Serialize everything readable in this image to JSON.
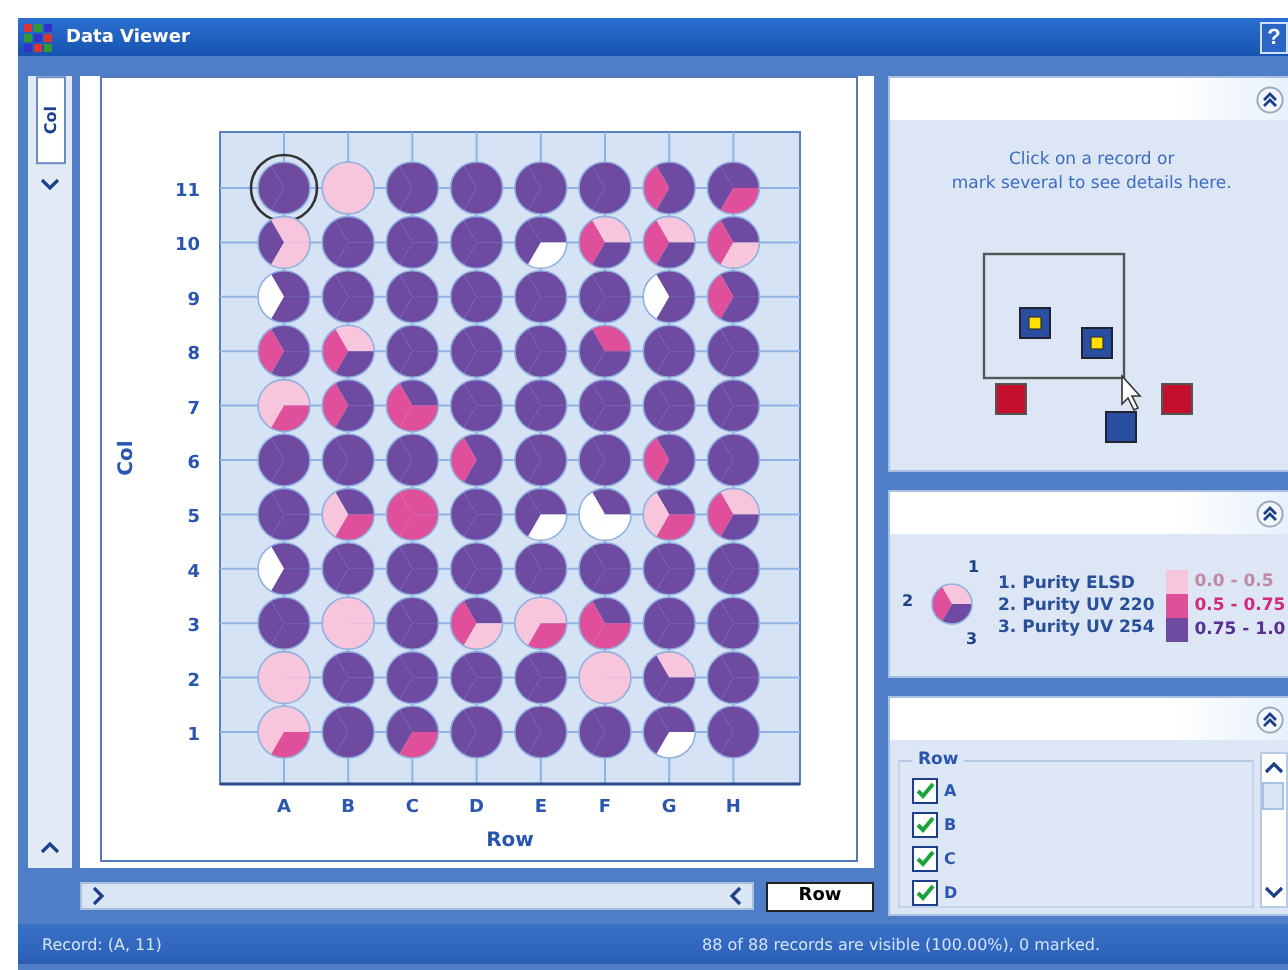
{
  "window": {
    "title": "Data Viewer",
    "help": "?"
  },
  "plot": {
    "tab": "Col",
    "y_title": "Col",
    "x_title": "Row",
    "columns": [
      "A",
      "B",
      "C",
      "D",
      "E",
      "F",
      "G",
      "H"
    ],
    "rows": [
      {
        "label": "11",
        "wells": [
          {
            "purity": [
              {
                "kind": "high"
              },
              {
                "kind": "high"
              },
              {
                "kind": "high"
              }
            ],
            "selected": true
          },
          {
            "purity": [
              {
                "kind": "low"
              },
              {
                "kind": "low"
              },
              {
                "kind": "low"
              }
            ],
            "selected": false
          },
          {
            "purity": [
              {
                "kind": "high"
              },
              {
                "kind": "high"
              },
              {
                "kind": "high"
              }
            ],
            "selected": false
          },
          {
            "purity": [
              {
                "kind": "high"
              },
              {
                "kind": "high"
              },
              {
                "kind": "high"
              }
            ],
            "selected": false
          },
          {
            "purity": [
              {
                "kind": "high"
              },
              {
                "kind": "high"
              },
              {
                "kind": "high"
              }
            ],
            "selected": false
          },
          {
            "purity": [
              {
                "kind": "high"
              },
              {
                "kind": "high"
              },
              {
                "kind": "high"
              }
            ],
            "selected": false
          },
          {
            "purity": [
              {
                "kind": "high"
              },
              {
                "kind": "mid"
              },
              {
                "kind": "high"
              }
            ],
            "selected": false
          },
          {
            "purity": [
              {
                "kind": "high"
              },
              {
                "kind": "high"
              },
              {
                "kind": "mid"
              }
            ],
            "selected": false
          }
        ]
      },
      {
        "label": "10",
        "wells": [
          {
            "purity": [
              {
                "kind": "low"
              },
              {
                "kind": "high"
              },
              {
                "kind": "low"
              }
            ],
            "selected": false
          },
          {
            "purity": [
              {
                "kind": "high"
              },
              {
                "kind": "high"
              },
              {
                "kind": "high"
              }
            ],
            "selected": false
          },
          {
            "purity": [
              {
                "kind": "high"
              },
              {
                "kind": "high"
              },
              {
                "kind": "high"
              }
            ],
            "selected": false
          },
          {
            "purity": [
              {
                "kind": "high"
              },
              {
                "kind": "high"
              },
              {
                "kind": "high"
              }
            ],
            "selected": false
          },
          {
            "purity": [
              {
                "kind": "high"
              },
              {
                "kind": "high"
              },
              {
                "kind": "none"
              }
            ],
            "selected": false
          },
          {
            "purity": [
              {
                "kind": "low"
              },
              {
                "kind": "mid"
              },
              {
                "kind": "high"
              }
            ],
            "selected": false
          },
          {
            "purity": [
              {
                "kind": "low"
              },
              {
                "kind": "mid"
              },
              {
                "kind": "high"
              }
            ],
            "selected": false
          },
          {
            "purity": [
              {
                "kind": "high"
              },
              {
                "kind": "mid"
              },
              {
                "kind": "low"
              }
            ],
            "selected": false
          }
        ]
      },
      {
        "label": "9",
        "wells": [
          {
            "purity": [
              {
                "kind": "high"
              },
              {
                "kind": "none"
              },
              {
                "kind": "high"
              }
            ],
            "selected": false
          },
          {
            "purity": [
              {
                "kind": "high"
              },
              {
                "kind": "high"
              },
              {
                "kind": "high"
              }
            ],
            "selected": false
          },
          {
            "purity": [
              {
                "kind": "high"
              },
              {
                "kind": "high"
              },
              {
                "kind": "high"
              }
            ],
            "selected": false
          },
          {
            "purity": [
              {
                "kind": "high"
              },
              {
                "kind": "high"
              },
              {
                "kind": "high"
              }
            ],
            "selected": false
          },
          {
            "purity": [
              {
                "kind": "high"
              },
              {
                "kind": "high"
              },
              {
                "kind": "high"
              }
            ],
            "selected": false
          },
          {
            "purity": [
              {
                "kind": "high"
              },
              {
                "kind": "high"
              },
              {
                "kind": "high"
              }
            ],
            "selected": false
          },
          {
            "purity": [
              {
                "kind": "high"
              },
              {
                "kind": "none"
              },
              {
                "kind": "high"
              }
            ],
            "selected": false
          },
          {
            "purity": [
              {
                "kind": "high"
              },
              {
                "kind": "mid"
              },
              {
                "kind": "high"
              }
            ],
            "selected": false
          }
        ]
      },
      {
        "label": "8",
        "wells": [
          {
            "purity": [
              {
                "kind": "high"
              },
              {
                "kind": "mid"
              },
              {
                "kind": "high"
              }
            ],
            "selected": false
          },
          {
            "purity": [
              {
                "kind": "low"
              },
              {
                "kind": "mid"
              },
              {
                "kind": "high"
              }
            ],
            "selected": false
          },
          {
            "purity": [
              {
                "kind": "high"
              },
              {
                "kind": "high"
              },
              {
                "kind": "high"
              }
            ],
            "selected": false
          },
          {
            "purity": [
              {
                "kind": "high"
              },
              {
                "kind": "high"
              },
              {
                "kind": "high"
              }
            ],
            "selected": false
          },
          {
            "purity": [
              {
                "kind": "high"
              },
              {
                "kind": "high"
              },
              {
                "kind": "high"
              }
            ],
            "selected": false
          },
          {
            "purity": [
              {
                "kind": "mid"
              },
              {
                "kind": "high"
              },
              {
                "kind": "high"
              }
            ],
            "selected": false
          },
          {
            "purity": [
              {
                "kind": "high"
              },
              {
                "kind": "high"
              },
              {
                "kind": "high"
              }
            ],
            "selected": false
          },
          {
            "purity": [
              {
                "kind": "high"
              },
              {
                "kind": "high"
              },
              {
                "kind": "high"
              }
            ],
            "selected": false
          }
        ]
      },
      {
        "label": "7",
        "wells": [
          {
            "purity": [
              {
                "kind": "low"
              },
              {
                "kind": "low"
              },
              {
                "kind": "mid"
              }
            ],
            "selected": false
          },
          {
            "purity": [
              {
                "kind": "high"
              },
              {
                "kind": "mid"
              },
              {
                "kind": "high"
              }
            ],
            "selected": false
          },
          {
            "purity": [
              {
                "kind": "high"
              },
              {
                "kind": "mid"
              },
              {
                "kind": "mid"
              }
            ],
            "selected": false
          },
          {
            "purity": [
              {
                "kind": "high"
              },
              {
                "kind": "high"
              },
              {
                "kind": "high"
              }
            ],
            "selected": false
          },
          {
            "purity": [
              {
                "kind": "high"
              },
              {
                "kind": "high"
              },
              {
                "kind": "high"
              }
            ],
            "selected": false
          },
          {
            "purity": [
              {
                "kind": "high"
              },
              {
                "kind": "high"
              },
              {
                "kind": "high"
              }
            ],
            "selected": false
          },
          {
            "purity": [
              {
                "kind": "high"
              },
              {
                "kind": "high"
              },
              {
                "kind": "high"
              }
            ],
            "selected": false
          },
          {
            "purity": [
              {
                "kind": "high"
              },
              {
                "kind": "high"
              },
              {
                "kind": "high"
              }
            ],
            "selected": false
          }
        ]
      },
      {
        "label": "6",
        "wells": [
          {
            "purity": [
              {
                "kind": "high"
              },
              {
                "kind": "high"
              },
              {
                "kind": "high"
              }
            ],
            "selected": false
          },
          {
            "purity": [
              {
                "kind": "high"
              },
              {
                "kind": "high"
              },
              {
                "kind": "high"
              }
            ],
            "selected": false
          },
          {
            "purity": [
              {
                "kind": "high"
              },
              {
                "kind": "high"
              },
              {
                "kind": "high"
              }
            ],
            "selected": false
          },
          {
            "purity": [
              {
                "kind": "high"
              },
              {
                "kind": "mid"
              },
              {
                "kind": "high"
              }
            ],
            "selected": false
          },
          {
            "purity": [
              {
                "kind": "high"
              },
              {
                "kind": "high"
              },
              {
                "kind": "high"
              }
            ],
            "selected": false
          },
          {
            "purity": [
              {
                "kind": "high"
              },
              {
                "kind": "high"
              },
              {
                "kind": "high"
              }
            ],
            "selected": false
          },
          {
            "purity": [
              {
                "kind": "high"
              },
              {
                "kind": "mid"
              },
              {
                "kind": "high"
              }
            ],
            "selected": false
          },
          {
            "purity": [
              {
                "kind": "high"
              },
              {
                "kind": "high"
              },
              {
                "kind": "high"
              }
            ],
            "selected": false
          }
        ]
      },
      {
        "label": "5",
        "wells": [
          {
            "purity": [
              {
                "kind": "high"
              },
              {
                "kind": "high"
              },
              {
                "kind": "high"
              }
            ],
            "selected": false
          },
          {
            "purity": [
              {
                "kind": "high"
              },
              {
                "kind": "low"
              },
              {
                "kind": "mid"
              }
            ],
            "selected": false
          },
          {
            "purity": [
              {
                "kind": "mid"
              },
              {
                "kind": "mid"
              },
              {
                "kind": "mid"
              }
            ],
            "selected": false
          },
          {
            "purity": [
              {
                "kind": "high"
              },
              {
                "kind": "high"
              },
              {
                "kind": "high"
              }
            ],
            "selected": false
          },
          {
            "purity": [
              {
                "kind": "high"
              },
              {
                "kind": "high"
              },
              {
                "kind": "none"
              }
            ],
            "selected": false
          },
          {
            "purity": [
              {
                "kind": "high"
              },
              {
                "kind": "none"
              },
              {
                "kind": "none"
              }
            ],
            "selected": false
          },
          {
            "purity": [
              {
                "kind": "high"
              },
              {
                "kind": "low"
              },
              {
                "kind": "mid"
              }
            ],
            "selected": false
          },
          {
            "purity": [
              {
                "kind": "low"
              },
              {
                "kind": "mid"
              },
              {
                "kind": "high"
              }
            ],
            "selected": false
          }
        ]
      },
      {
        "label": "4",
        "wells": [
          {
            "purity": [
              {
                "kind": "high"
              },
              {
                "kind": "none"
              },
              {
                "kind": "high"
              }
            ],
            "selected": false
          },
          {
            "purity": [
              {
                "kind": "high"
              },
              {
                "kind": "high"
              },
              {
                "kind": "high"
              }
            ],
            "selected": false
          },
          {
            "purity": [
              {
                "kind": "high"
              },
              {
                "kind": "high"
              },
              {
                "kind": "high"
              }
            ],
            "selected": false
          },
          {
            "purity": [
              {
                "kind": "high"
              },
              {
                "kind": "high"
              },
              {
                "kind": "high"
              }
            ],
            "selected": false
          },
          {
            "purity": [
              {
                "kind": "high"
              },
              {
                "kind": "high"
              },
              {
                "kind": "high"
              }
            ],
            "selected": false
          },
          {
            "purity": [
              {
                "kind": "high"
              },
              {
                "kind": "high"
              },
              {
                "kind": "high"
              }
            ],
            "selected": false
          },
          {
            "purity": [
              {
                "kind": "high"
              },
              {
                "kind": "high"
              },
              {
                "kind": "high"
              }
            ],
            "selected": false
          },
          {
            "purity": [
              {
                "kind": "high"
              },
              {
                "kind": "high"
              },
              {
                "kind": "high"
              }
            ],
            "selected": false
          }
        ]
      },
      {
        "label": "3",
        "wells": [
          {
            "purity": [
              {
                "kind": "high"
              },
              {
                "kind": "high"
              },
              {
                "kind": "high"
              }
            ],
            "selected": false
          },
          {
            "purity": [
              {
                "kind": "low"
              },
              {
                "kind": "low"
              },
              {
                "kind": "low"
              }
            ],
            "selected": false
          },
          {
            "purity": [
              {
                "kind": "high"
              },
              {
                "kind": "high"
              },
              {
                "kind": "high"
              }
            ],
            "selected": false
          },
          {
            "purity": [
              {
                "kind": "high"
              },
              {
                "kind": "mid"
              },
              {
                "kind": "low"
              }
            ],
            "selected": false
          },
          {
            "purity": [
              {
                "kind": "low"
              },
              {
                "kind": "low"
              },
              {
                "kind": "mid"
              }
            ],
            "selected": false
          },
          {
            "purity": [
              {
                "kind": "high"
              },
              {
                "kind": "mid"
              },
              {
                "kind": "mid"
              }
            ],
            "selected": false
          },
          {
            "purity": [
              {
                "kind": "high"
              },
              {
                "kind": "high"
              },
              {
                "kind": "high"
              }
            ],
            "selected": false
          },
          {
            "purity": [
              {
                "kind": "high"
              },
              {
                "kind": "high"
              },
              {
                "kind": "high"
              }
            ],
            "selected": false
          }
        ]
      },
      {
        "label": "2",
        "wells": [
          {
            "purity": [
              {
                "kind": "low"
              },
              {
                "kind": "low"
              },
              {
                "kind": "low"
              }
            ],
            "selected": false
          },
          {
            "purity": [
              {
                "kind": "high"
              },
              {
                "kind": "high"
              },
              {
                "kind": "high"
              }
            ],
            "selected": false
          },
          {
            "purity": [
              {
                "kind": "high"
              },
              {
                "kind": "high"
              },
              {
                "kind": "high"
              }
            ],
            "selected": false
          },
          {
            "purity": [
              {
                "kind": "high"
              },
              {
                "kind": "high"
              },
              {
                "kind": "high"
              }
            ],
            "selected": false
          },
          {
            "purity": [
              {
                "kind": "high"
              },
              {
                "kind": "high"
              },
              {
                "kind": "high"
              }
            ],
            "selected": false
          },
          {
            "purity": [
              {
                "kind": "low"
              },
              {
                "kind": "low"
              },
              {
                "kind": "low"
              }
            ],
            "selected": false
          },
          {
            "purity": [
              {
                "kind": "low"
              },
              {
                "kind": "high"
              },
              {
                "kind": "high"
              }
            ],
            "selected": false
          },
          {
            "purity": [
              {
                "kind": "high"
              },
              {
                "kind": "high"
              },
              {
                "kind": "high"
              }
            ],
            "selected": false
          }
        ]
      },
      {
        "label": "1",
        "wells": [
          {
            "purity": [
              {
                "kind": "low"
              },
              {
                "kind": "low"
              },
              {
                "kind": "mid"
              }
            ],
            "selected": false
          },
          {
            "purity": [
              {
                "kind": "high"
              },
              {
                "kind": "high"
              },
              {
                "kind": "high"
              }
            ],
            "selected": false
          },
          {
            "purity": [
              {
                "kind": "high"
              },
              {
                "kind": "high"
              },
              {
                "kind": "mid"
              }
            ],
            "selected": false
          },
          {
            "purity": [
              {
                "kind": "high"
              },
              {
                "kind": "high"
              },
              {
                "kind": "high"
              }
            ],
            "selected": false
          },
          {
            "purity": [
              {
                "kind": "high"
              },
              {
                "kind": "high"
              },
              {
                "kind": "high"
              }
            ],
            "selected": false
          },
          {
            "purity": [
              {
                "kind": "high"
              },
              {
                "kind": "high"
              },
              {
                "kind": "high"
              }
            ],
            "selected": false
          },
          {
            "purity": [
              {
                "kind": "high"
              },
              {
                "kind": "high"
              },
              {
                "kind": "none"
              }
            ],
            "selected": false
          },
          {
            "purity": [
              {
                "kind": "high"
              },
              {
                "kind": "high"
              },
              {
                "kind": "high"
              }
            ],
            "selected": false
          }
        ]
      }
    ]
  },
  "axis_button": "Row",
  "details": {
    "hint": "Click on a record or\nmark several to see details here."
  },
  "legend": {
    "glyph_labels": [
      "1",
      "2",
      "3"
    ],
    "measures": [
      "1. Purity ELSD",
      "2. Purity UV 220",
      "3. Purity UV 254"
    ],
    "ranges": [
      {
        "label": "0.0 - 0.5",
        "color": "#f7c6dc"
      },
      {
        "label": "0.5 - 0.75",
        "color": "#e0509a"
      },
      {
        "label": "0.75 - 1.0",
        "color": "#6e4aa0"
      }
    ]
  },
  "filter": {
    "group": "Row",
    "items": [
      {
        "label": "A",
        "checked": true
      },
      {
        "label": "B",
        "checked": true
      },
      {
        "label": "C",
        "checked": true
      },
      {
        "label": "D",
        "checked": true
      }
    ]
  },
  "status": {
    "record": "Record: (A, 11)",
    "summary": "88 of 88 records are visible (100.00%), 0 marked."
  }
}
